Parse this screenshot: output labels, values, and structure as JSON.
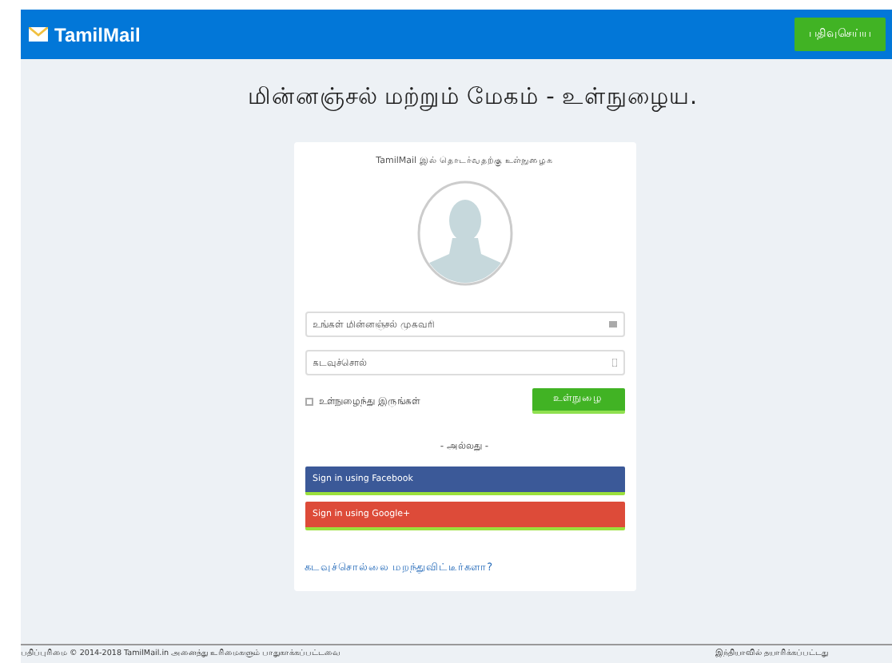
{
  "navbar": {
    "brand": "TamilMail",
    "register_button": "பதிவுசெய்ய"
  },
  "heading": "மின்னஞ்சல் மற்றும் மேகம் - உள்நுழைய.",
  "login_card": {
    "title": "TamilMail இல் தொடர்வதற்கு உள்நுழைக",
    "email": {
      "placeholder": "உங்கள் மின்னஞ்சல் முகவரி"
    },
    "password": {
      "placeholder": "கடவுச்சொல்"
    },
    "remember": {
      "label": "உள்நுழைந்து இருங்கள்",
      "checked": false
    },
    "submit": "உள்நுழை",
    "divider": "- அல்லது -",
    "social": [
      {
        "label": "Sign in using Facebook",
        "color": "#3b5998"
      },
      {
        "label": "Sign in using Google+",
        "color": "#dd4b39"
      }
    ],
    "forgot_link": "கடவுச்சொல்லை மறந்துவிட்டீர்களா?"
  },
  "footer": {
    "copyright": "பதிப்புரிமை © 2014-2018 TamilMail.in அனைத்து உரிமைகளும் பாதுகாக்கப்பட்டவை",
    "made_in": "இந்தியாவில் தயாரிக்கப்பட்டது"
  }
}
